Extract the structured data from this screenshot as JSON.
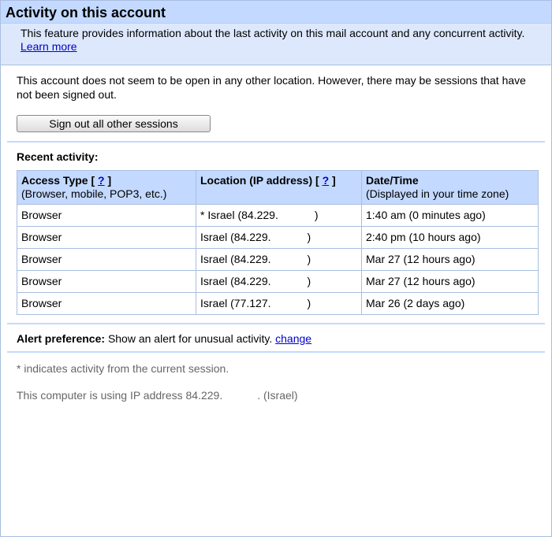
{
  "header": {
    "title": "Activity on this account",
    "description": "This feature provides information about the last activity on this mail account and any concurrent activity.",
    "learn_more": "Learn more"
  },
  "status": {
    "message": "This account does not seem to be open in any other location. However, there may be sessions that have not been signed out."
  },
  "actions": {
    "sign_out_label": "Sign out all other sessions"
  },
  "recent": {
    "label": "Recent activity:",
    "columns": [
      {
        "title": "Access Type",
        "help": "?",
        "subtitle": "(Browser, mobile, POP3, etc.)"
      },
      {
        "title": "Location (IP address)",
        "help": "?",
        "subtitle": ""
      },
      {
        "title": "Date/Time",
        "help": "",
        "subtitle": "(Displayed in your time zone)"
      }
    ],
    "rows": [
      {
        "type": "Browser",
        "location": "* Israel (84.229.",
        "loc_end": ")",
        "time": "1:40 am (0 minutes ago)"
      },
      {
        "type": "Browser",
        "location": "Israel (84.229.",
        "loc_end": ")",
        "time": "2:40 pm (10 hours ago)"
      },
      {
        "type": "Browser",
        "location": "Israel (84.229.",
        "loc_end": ")",
        "time": "Mar 27 (12 hours ago)"
      },
      {
        "type": "Browser",
        "location": "Israel (84.229.",
        "loc_end": ")",
        "time": "Mar 27 (12 hours ago)"
      },
      {
        "type": "Browser",
        "location": "Israel (77.127.",
        "loc_end": ")",
        "time": "Mar 26 (2 days ago)"
      }
    ]
  },
  "alert": {
    "label": "Alert preference:",
    "text": "Show an alert for unusual activity.",
    "change": "change"
  },
  "footer": {
    "note": "* indicates activity from the current session.",
    "ip_prefix": "This computer is using IP address 84.229.",
    "ip_suffix": ". (Israel)"
  }
}
